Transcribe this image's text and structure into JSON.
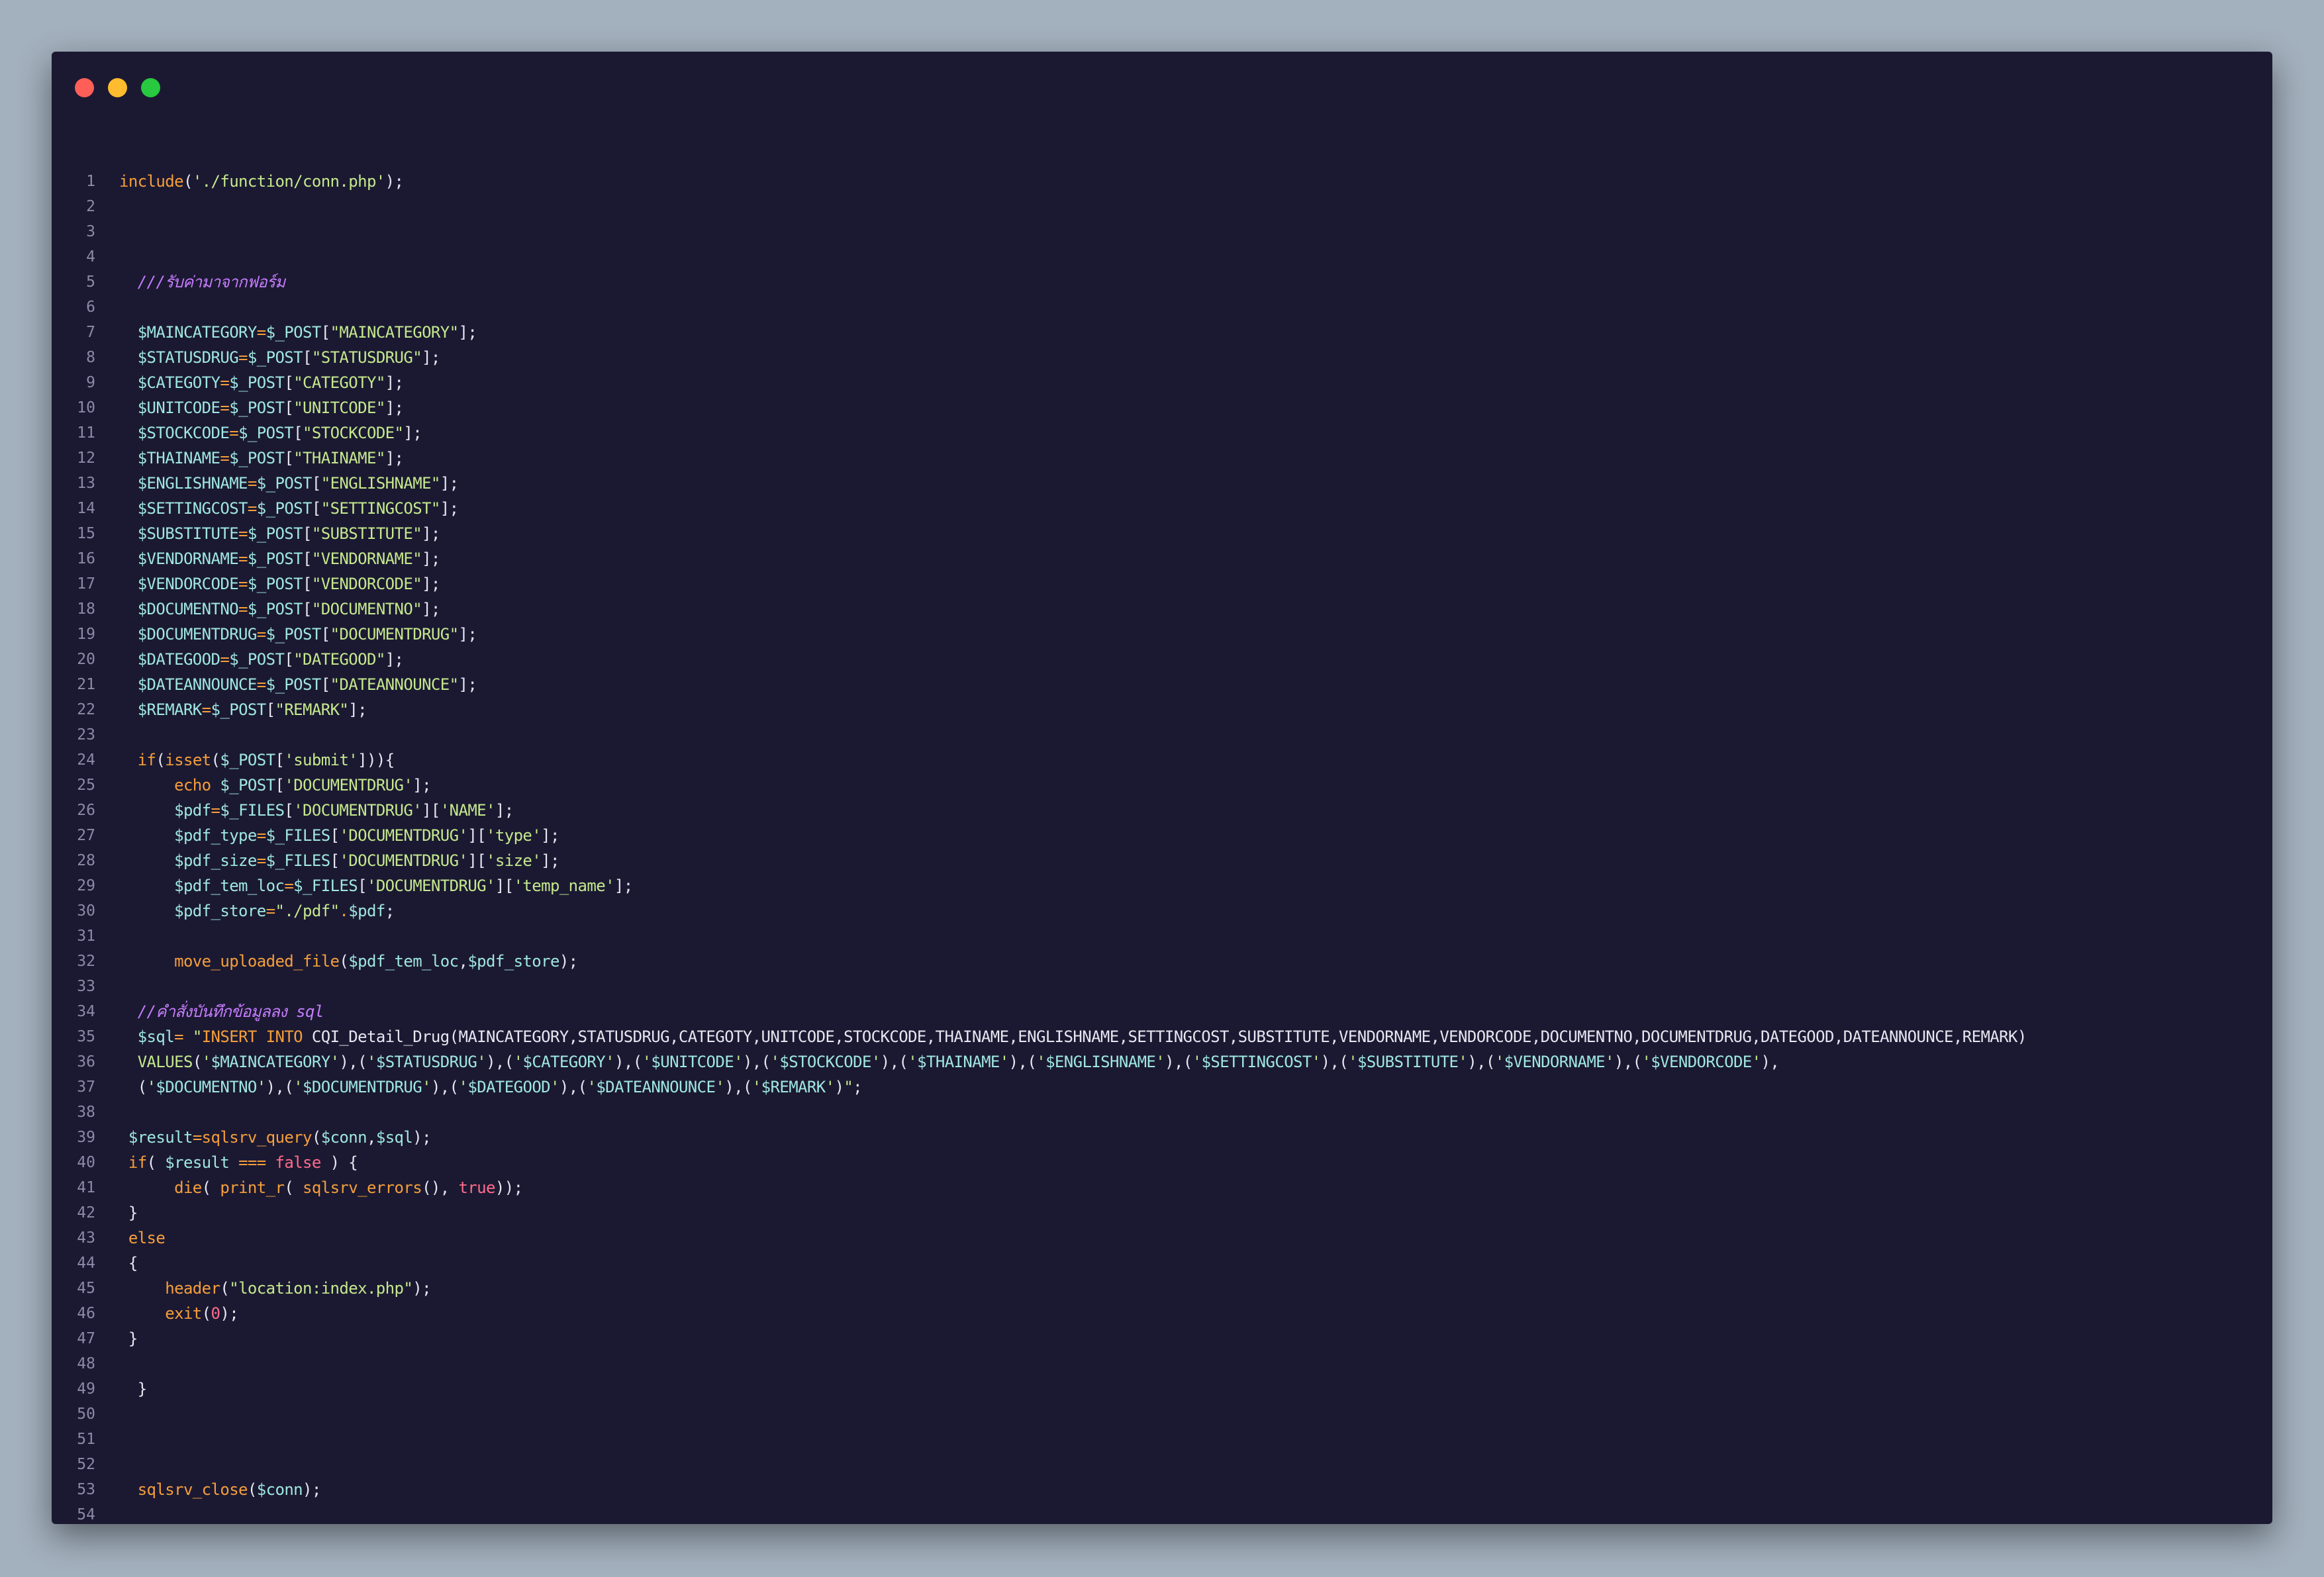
{
  "window": {
    "controls": [
      "close",
      "minimize",
      "maximize"
    ],
    "colors": {
      "close": "#ff5f57",
      "minimize": "#febc2e",
      "maximize": "#28c840",
      "background": "#1b1932"
    }
  },
  "lines": [
    [
      {
        "t": "fn",
        "v": "include"
      },
      {
        "t": "pl",
        "v": "("
      },
      {
        "t": "str",
        "v": "'./function/conn.php'"
      },
      {
        "t": "pl",
        "v": ");"
      }
    ],
    [],
    [],
    [],
    [
      {
        "t": "pl",
        "v": "  "
      },
      {
        "t": "cmt",
        "v": "///รับค่ามาจากฟอร์ม"
      }
    ],
    [],
    [
      {
        "t": "pl",
        "v": "  "
      },
      {
        "t": "var",
        "v": "$MAINCATEGORY"
      },
      {
        "t": "op",
        "v": "="
      },
      {
        "t": "var",
        "v": "$_POST"
      },
      {
        "t": "pl",
        "v": "["
      },
      {
        "t": "str",
        "v": "\"MAINCATEGORY\""
      },
      {
        "t": "pl",
        "v": "];"
      }
    ],
    [
      {
        "t": "pl",
        "v": "  "
      },
      {
        "t": "var",
        "v": "$STATUSDRUG"
      },
      {
        "t": "op",
        "v": "="
      },
      {
        "t": "var",
        "v": "$_POST"
      },
      {
        "t": "pl",
        "v": "["
      },
      {
        "t": "str",
        "v": "\"STATUSDRUG\""
      },
      {
        "t": "pl",
        "v": "];"
      }
    ],
    [
      {
        "t": "pl",
        "v": "  "
      },
      {
        "t": "var",
        "v": "$CATEGOTY"
      },
      {
        "t": "op",
        "v": "="
      },
      {
        "t": "var",
        "v": "$_POST"
      },
      {
        "t": "pl",
        "v": "["
      },
      {
        "t": "str",
        "v": "\"CATEGOTY\""
      },
      {
        "t": "pl",
        "v": "];"
      }
    ],
    [
      {
        "t": "pl",
        "v": "  "
      },
      {
        "t": "var",
        "v": "$UNITCODE"
      },
      {
        "t": "op",
        "v": "="
      },
      {
        "t": "var",
        "v": "$_POST"
      },
      {
        "t": "pl",
        "v": "["
      },
      {
        "t": "str",
        "v": "\"UNITCODE\""
      },
      {
        "t": "pl",
        "v": "];"
      }
    ],
    [
      {
        "t": "pl",
        "v": "  "
      },
      {
        "t": "var",
        "v": "$STOCKCODE"
      },
      {
        "t": "op",
        "v": "="
      },
      {
        "t": "var",
        "v": "$_POST"
      },
      {
        "t": "pl",
        "v": "["
      },
      {
        "t": "str",
        "v": "\"STOCKCODE\""
      },
      {
        "t": "pl",
        "v": "];"
      }
    ],
    [
      {
        "t": "pl",
        "v": "  "
      },
      {
        "t": "var",
        "v": "$THAINAME"
      },
      {
        "t": "op",
        "v": "="
      },
      {
        "t": "var",
        "v": "$_POST"
      },
      {
        "t": "pl",
        "v": "["
      },
      {
        "t": "str",
        "v": "\"THAINAME\""
      },
      {
        "t": "pl",
        "v": "];"
      }
    ],
    [
      {
        "t": "pl",
        "v": "  "
      },
      {
        "t": "var",
        "v": "$ENGLISHNAME"
      },
      {
        "t": "op",
        "v": "="
      },
      {
        "t": "var",
        "v": "$_POST"
      },
      {
        "t": "pl",
        "v": "["
      },
      {
        "t": "str",
        "v": "\"ENGLISHNAME\""
      },
      {
        "t": "pl",
        "v": "];"
      }
    ],
    [
      {
        "t": "pl",
        "v": "  "
      },
      {
        "t": "var",
        "v": "$SETTINGCOST"
      },
      {
        "t": "op",
        "v": "="
      },
      {
        "t": "var",
        "v": "$_POST"
      },
      {
        "t": "pl",
        "v": "["
      },
      {
        "t": "str",
        "v": "\"SETTINGCOST\""
      },
      {
        "t": "pl",
        "v": "];"
      }
    ],
    [
      {
        "t": "pl",
        "v": "  "
      },
      {
        "t": "var",
        "v": "$SUBSTITUTE"
      },
      {
        "t": "op",
        "v": "="
      },
      {
        "t": "var",
        "v": "$_POST"
      },
      {
        "t": "pl",
        "v": "["
      },
      {
        "t": "str",
        "v": "\"SUBSTITUTE\""
      },
      {
        "t": "pl",
        "v": "];"
      }
    ],
    [
      {
        "t": "pl",
        "v": "  "
      },
      {
        "t": "var",
        "v": "$VENDORNAME"
      },
      {
        "t": "op",
        "v": "="
      },
      {
        "t": "var",
        "v": "$_POST"
      },
      {
        "t": "pl",
        "v": "["
      },
      {
        "t": "str",
        "v": "\"VENDORNAME\""
      },
      {
        "t": "pl",
        "v": "];"
      }
    ],
    [
      {
        "t": "pl",
        "v": "  "
      },
      {
        "t": "var",
        "v": "$VENDORCODE"
      },
      {
        "t": "op",
        "v": "="
      },
      {
        "t": "var",
        "v": "$_POST"
      },
      {
        "t": "pl",
        "v": "["
      },
      {
        "t": "str",
        "v": "\"VENDORCODE\""
      },
      {
        "t": "pl",
        "v": "];"
      }
    ],
    [
      {
        "t": "pl",
        "v": "  "
      },
      {
        "t": "var",
        "v": "$DOCUMENTNO"
      },
      {
        "t": "op",
        "v": "="
      },
      {
        "t": "var",
        "v": "$_POST"
      },
      {
        "t": "pl",
        "v": "["
      },
      {
        "t": "str",
        "v": "\"DOCUMENTNO\""
      },
      {
        "t": "pl",
        "v": "];"
      }
    ],
    [
      {
        "t": "pl",
        "v": "  "
      },
      {
        "t": "var",
        "v": "$DOCUMENTDRUG"
      },
      {
        "t": "op",
        "v": "="
      },
      {
        "t": "var",
        "v": "$_POST"
      },
      {
        "t": "pl",
        "v": "["
      },
      {
        "t": "str",
        "v": "\"DOCUMENTDRUG\""
      },
      {
        "t": "pl",
        "v": "];"
      }
    ],
    [
      {
        "t": "pl",
        "v": "  "
      },
      {
        "t": "var",
        "v": "$DATEGOOD"
      },
      {
        "t": "op",
        "v": "="
      },
      {
        "t": "var",
        "v": "$_POST"
      },
      {
        "t": "pl",
        "v": "["
      },
      {
        "t": "str",
        "v": "\"DATEGOOD\""
      },
      {
        "t": "pl",
        "v": "];"
      }
    ],
    [
      {
        "t": "pl",
        "v": "  "
      },
      {
        "t": "var",
        "v": "$DATEANNOUNCE"
      },
      {
        "t": "op",
        "v": "="
      },
      {
        "t": "var",
        "v": "$_POST"
      },
      {
        "t": "pl",
        "v": "["
      },
      {
        "t": "str",
        "v": "\"DATEANNOUNCE\""
      },
      {
        "t": "pl",
        "v": "];"
      }
    ],
    [
      {
        "t": "pl",
        "v": "  "
      },
      {
        "t": "var",
        "v": "$REMARK"
      },
      {
        "t": "op",
        "v": "="
      },
      {
        "t": "var",
        "v": "$_POST"
      },
      {
        "t": "pl",
        "v": "["
      },
      {
        "t": "str",
        "v": "\"REMARK\""
      },
      {
        "t": "pl",
        "v": "];"
      }
    ],
    [],
    [
      {
        "t": "pl",
        "v": "  "
      },
      {
        "t": "kw",
        "v": "if"
      },
      {
        "t": "pl",
        "v": "("
      },
      {
        "t": "fn",
        "v": "isset"
      },
      {
        "t": "pl",
        "v": "("
      },
      {
        "t": "var",
        "v": "$_POST"
      },
      {
        "t": "pl",
        "v": "["
      },
      {
        "t": "str",
        "v": "'submit'"
      },
      {
        "t": "pl",
        "v": "])){"
      }
    ],
    [
      {
        "t": "pl",
        "v": "      "
      },
      {
        "t": "kw",
        "v": "echo"
      },
      {
        "t": "pl",
        "v": " "
      },
      {
        "t": "var",
        "v": "$_POST"
      },
      {
        "t": "pl",
        "v": "["
      },
      {
        "t": "str",
        "v": "'DOCUMENTDRUG'"
      },
      {
        "t": "pl",
        "v": "];"
      }
    ],
    [
      {
        "t": "pl",
        "v": "      "
      },
      {
        "t": "var",
        "v": "$pdf"
      },
      {
        "t": "op",
        "v": "="
      },
      {
        "t": "var",
        "v": "$_FILES"
      },
      {
        "t": "pl",
        "v": "["
      },
      {
        "t": "str",
        "v": "'DOCUMENTDRUG'"
      },
      {
        "t": "pl",
        "v": "]["
      },
      {
        "t": "str",
        "v": "'NAME'"
      },
      {
        "t": "pl",
        "v": "];"
      }
    ],
    [
      {
        "t": "pl",
        "v": "      "
      },
      {
        "t": "var",
        "v": "$pdf_type"
      },
      {
        "t": "op",
        "v": "="
      },
      {
        "t": "var",
        "v": "$_FILES"
      },
      {
        "t": "pl",
        "v": "["
      },
      {
        "t": "str",
        "v": "'DOCUMENTDRUG'"
      },
      {
        "t": "pl",
        "v": "]["
      },
      {
        "t": "str",
        "v": "'type'"
      },
      {
        "t": "pl",
        "v": "];"
      }
    ],
    [
      {
        "t": "pl",
        "v": "      "
      },
      {
        "t": "var",
        "v": "$pdf_size"
      },
      {
        "t": "op",
        "v": "="
      },
      {
        "t": "var",
        "v": "$_FILES"
      },
      {
        "t": "pl",
        "v": "["
      },
      {
        "t": "str",
        "v": "'DOCUMENTDRUG'"
      },
      {
        "t": "pl",
        "v": "]["
      },
      {
        "t": "str",
        "v": "'size'"
      },
      {
        "t": "pl",
        "v": "];"
      }
    ],
    [
      {
        "t": "pl",
        "v": "      "
      },
      {
        "t": "var",
        "v": "$pdf_tem_loc"
      },
      {
        "t": "op",
        "v": "="
      },
      {
        "t": "var",
        "v": "$_FILES"
      },
      {
        "t": "pl",
        "v": "["
      },
      {
        "t": "str",
        "v": "'DOCUMENTDRUG'"
      },
      {
        "t": "pl",
        "v": "]["
      },
      {
        "t": "str",
        "v": "'temp_name'"
      },
      {
        "t": "pl",
        "v": "];"
      }
    ],
    [
      {
        "t": "pl",
        "v": "      "
      },
      {
        "t": "var",
        "v": "$pdf_store"
      },
      {
        "t": "op",
        "v": "="
      },
      {
        "t": "str",
        "v": "\"./pdf\""
      },
      {
        "t": "op",
        "v": "."
      },
      {
        "t": "var",
        "v": "$pdf"
      },
      {
        "t": "pl",
        "v": ";"
      }
    ],
    [],
    [
      {
        "t": "pl",
        "v": "      "
      },
      {
        "t": "fn",
        "v": "move_uploaded_file"
      },
      {
        "t": "pl",
        "v": "("
      },
      {
        "t": "var",
        "v": "$pdf_tem_loc"
      },
      {
        "t": "pl",
        "v": ","
      },
      {
        "t": "var",
        "v": "$pdf_store"
      },
      {
        "t": "pl",
        "v": ");"
      }
    ],
    [],
    [
      {
        "t": "pl",
        "v": "  "
      },
      {
        "t": "cmt",
        "v": "//คำสั่งบันทึกข้อมูลลง sql"
      }
    ],
    [
      {
        "t": "pl",
        "v": "  "
      },
      {
        "t": "var",
        "v": "$sql"
      },
      {
        "t": "op",
        "v": "="
      },
      {
        "t": "pl",
        "v": " "
      },
      {
        "t": "str",
        "v": "\""
      },
      {
        "t": "kw",
        "v": "INSERT INTO"
      },
      {
        "t": "pl",
        "v": " CQI_Detail_Drug(MAINCATEGORY,STATUSDRUG,CATEGOTY,UNITCODE,STOCKCODE,THAINAME,ENGLISHNAME,SETTINGCOST,SUBSTITUTE,VENDORNAME,VENDORCODE,DOCUMENTNO,DOCUMENTDRUG,DATEGOOD,DATEANNOUNCE,REMARK)"
      }
    ],
    [
      {
        "t": "pl",
        "v": "  "
      },
      {
        "t": "str",
        "v": "VALUES"
      },
      {
        "t": "pl",
        "v": "("
      },
      {
        "t": "str",
        "v": "'"
      },
      {
        "t": "var",
        "v": "$MAINCATEGORY"
      },
      {
        "t": "str",
        "v": "'"
      },
      {
        "t": "pl",
        "v": "),("
      },
      {
        "t": "str",
        "v": "'"
      },
      {
        "t": "var",
        "v": "$STATUSDRUG"
      },
      {
        "t": "str",
        "v": "'"
      },
      {
        "t": "pl",
        "v": "),("
      },
      {
        "t": "str",
        "v": "'"
      },
      {
        "t": "var",
        "v": "$CATEGORY"
      },
      {
        "t": "str",
        "v": "'"
      },
      {
        "t": "pl",
        "v": "),("
      },
      {
        "t": "str",
        "v": "'"
      },
      {
        "t": "var",
        "v": "$UNITCODE"
      },
      {
        "t": "str",
        "v": "'"
      },
      {
        "t": "pl",
        "v": "),("
      },
      {
        "t": "str",
        "v": "'"
      },
      {
        "t": "var",
        "v": "$STOCKCODE"
      },
      {
        "t": "str",
        "v": "'"
      },
      {
        "t": "pl",
        "v": "),("
      },
      {
        "t": "str",
        "v": "'"
      },
      {
        "t": "var",
        "v": "$THAINAME"
      },
      {
        "t": "str",
        "v": "'"
      },
      {
        "t": "pl",
        "v": "),("
      },
      {
        "t": "str",
        "v": "'"
      },
      {
        "t": "var",
        "v": "$ENGLISHNAME"
      },
      {
        "t": "str",
        "v": "'"
      },
      {
        "t": "pl",
        "v": "),("
      },
      {
        "t": "str",
        "v": "'"
      },
      {
        "t": "var",
        "v": "$SETTINGCOST"
      },
      {
        "t": "str",
        "v": "'"
      },
      {
        "t": "pl",
        "v": "),("
      },
      {
        "t": "str",
        "v": "'"
      },
      {
        "t": "var",
        "v": "$SUBSTITUTE"
      },
      {
        "t": "str",
        "v": "'"
      },
      {
        "t": "pl",
        "v": "),("
      },
      {
        "t": "str",
        "v": "'"
      },
      {
        "t": "var",
        "v": "$VENDORNAME"
      },
      {
        "t": "str",
        "v": "'"
      },
      {
        "t": "pl",
        "v": "),("
      },
      {
        "t": "str",
        "v": "'"
      },
      {
        "t": "var",
        "v": "$VENDORCODE"
      },
      {
        "t": "str",
        "v": "'"
      },
      {
        "t": "pl",
        "v": "),"
      }
    ],
    [
      {
        "t": "pl",
        "v": "  ("
      },
      {
        "t": "str",
        "v": "'"
      },
      {
        "t": "var",
        "v": "$DOCUMENTNO"
      },
      {
        "t": "str",
        "v": "'"
      },
      {
        "t": "pl",
        "v": "),("
      },
      {
        "t": "str",
        "v": "'"
      },
      {
        "t": "var",
        "v": "$DOCUMENTDRUG"
      },
      {
        "t": "str",
        "v": "'"
      },
      {
        "t": "pl",
        "v": "),("
      },
      {
        "t": "str",
        "v": "'"
      },
      {
        "t": "var",
        "v": "$DATEGOOD"
      },
      {
        "t": "str",
        "v": "'"
      },
      {
        "t": "pl",
        "v": "),("
      },
      {
        "t": "str",
        "v": "'"
      },
      {
        "t": "var",
        "v": "$DATEANNOUNCE"
      },
      {
        "t": "str",
        "v": "'"
      },
      {
        "t": "pl",
        "v": "),("
      },
      {
        "t": "str",
        "v": "'"
      },
      {
        "t": "var",
        "v": "$REMARK"
      },
      {
        "t": "str",
        "v": "'"
      },
      {
        "t": "pl",
        "v": ")"
      },
      {
        "t": "str",
        "v": "\""
      },
      {
        "t": "pl",
        "v": ";"
      }
    ],
    [],
    [
      {
        "t": "pl",
        "v": " "
      },
      {
        "t": "var",
        "v": "$result"
      },
      {
        "t": "op",
        "v": "="
      },
      {
        "t": "fn",
        "v": "sqlsrv_query"
      },
      {
        "t": "pl",
        "v": "("
      },
      {
        "t": "var",
        "v": "$conn"
      },
      {
        "t": "pl",
        "v": ","
      },
      {
        "t": "var",
        "v": "$sql"
      },
      {
        "t": "pl",
        "v": ");"
      }
    ],
    [
      {
        "t": "pl",
        "v": " "
      },
      {
        "t": "kw",
        "v": "if"
      },
      {
        "t": "pl",
        "v": "( "
      },
      {
        "t": "var",
        "v": "$result"
      },
      {
        "t": "pl",
        "v": " "
      },
      {
        "t": "op",
        "v": "==="
      },
      {
        "t": "pl",
        "v": " "
      },
      {
        "t": "bool",
        "v": "false"
      },
      {
        "t": "pl",
        "v": " ) {"
      }
    ],
    [
      {
        "t": "pl",
        "v": "      "
      },
      {
        "t": "fn",
        "v": "die"
      },
      {
        "t": "pl",
        "v": "( "
      },
      {
        "t": "fn",
        "v": "print_r"
      },
      {
        "t": "pl",
        "v": "( "
      },
      {
        "t": "fn",
        "v": "sqlsrv_errors"
      },
      {
        "t": "pl",
        "v": "(), "
      },
      {
        "t": "bool",
        "v": "true"
      },
      {
        "t": "pl",
        "v": "));"
      }
    ],
    [
      {
        "t": "pl",
        "v": " }"
      }
    ],
    [
      {
        "t": "pl",
        "v": " "
      },
      {
        "t": "kw",
        "v": "else"
      }
    ],
    [
      {
        "t": "pl",
        "v": " {"
      }
    ],
    [
      {
        "t": "pl",
        "v": "     "
      },
      {
        "t": "fn",
        "v": "header"
      },
      {
        "t": "pl",
        "v": "("
      },
      {
        "t": "str",
        "v": "\"location:index.php\""
      },
      {
        "t": "pl",
        "v": ");"
      }
    ],
    [
      {
        "t": "pl",
        "v": "     "
      },
      {
        "t": "fn",
        "v": "exit"
      },
      {
        "t": "pl",
        "v": "("
      },
      {
        "t": "num",
        "v": "0"
      },
      {
        "t": "pl",
        "v": ");"
      }
    ],
    [
      {
        "t": "pl",
        "v": " }"
      }
    ],
    [],
    [
      {
        "t": "pl",
        "v": "  }"
      }
    ],
    [],
    [],
    [],
    [
      {
        "t": "pl",
        "v": "  "
      },
      {
        "t": "fn",
        "v": "sqlsrv_close"
      },
      {
        "t": "pl",
        "v": "("
      },
      {
        "t": "var",
        "v": "$conn"
      },
      {
        "t": "pl",
        "v": ");"
      }
    ],
    [],
    []
  ]
}
